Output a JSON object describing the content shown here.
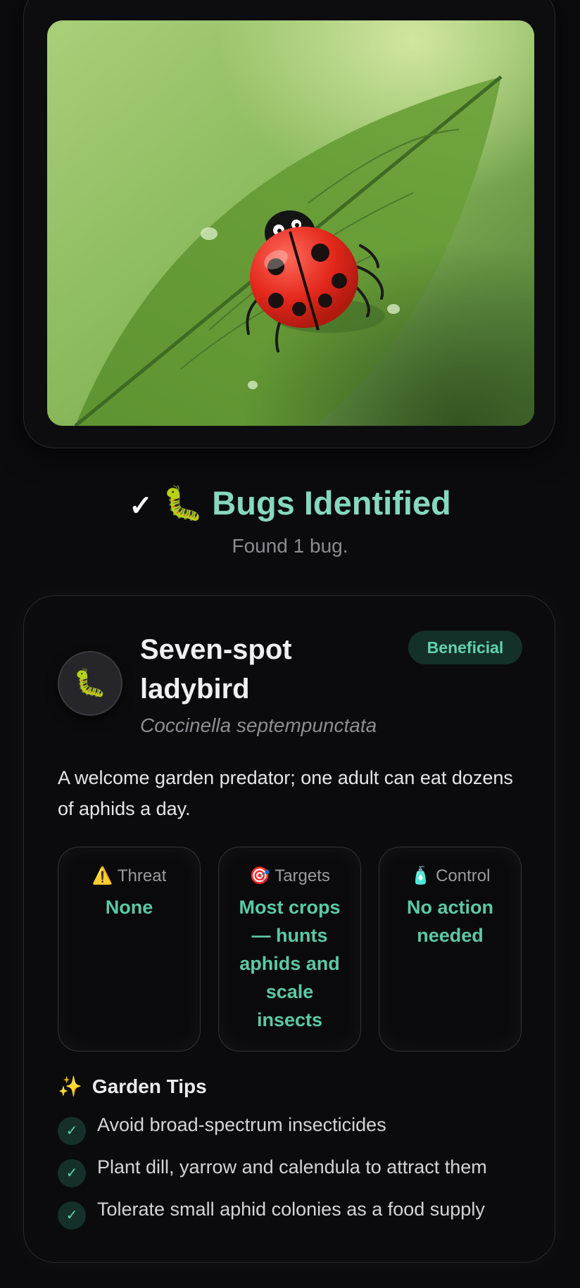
{
  "header": {
    "check_icon": "✓",
    "bug_emoji": "🐛",
    "title": "Bugs Identified",
    "subtitle": "Found 1 bug."
  },
  "bug": {
    "avatar_emoji": "🐛",
    "common_name": "Seven-spot ladybird",
    "scientific_name": "Coccinella septempunctata",
    "badge": "Beneficial",
    "description": "A welcome garden predator; one adult can eat dozens of aphids a day.",
    "stats": [
      {
        "icon": "⚠️",
        "label": "Threat",
        "value": "None"
      },
      {
        "icon": "🎯",
        "label": "Targets",
        "value": "Most crops — hunts aphids and scale insects"
      },
      {
        "icon": "🧴",
        "label": "Control",
        "value": "No action needed"
      }
    ]
  },
  "tips": {
    "icon": "✨",
    "title": "Garden Tips",
    "items": [
      "Avoid broad-spectrum insecticides",
      "Plant dill, yarrow and calendula to attract them",
      "Tolerate small aphid colonies as a food supply"
    ]
  },
  "colors": {
    "accent": "#86d8c0",
    "badge_bg": "#14302a",
    "badge_text": "#5fd3b0",
    "background": "#0b0b0d"
  }
}
